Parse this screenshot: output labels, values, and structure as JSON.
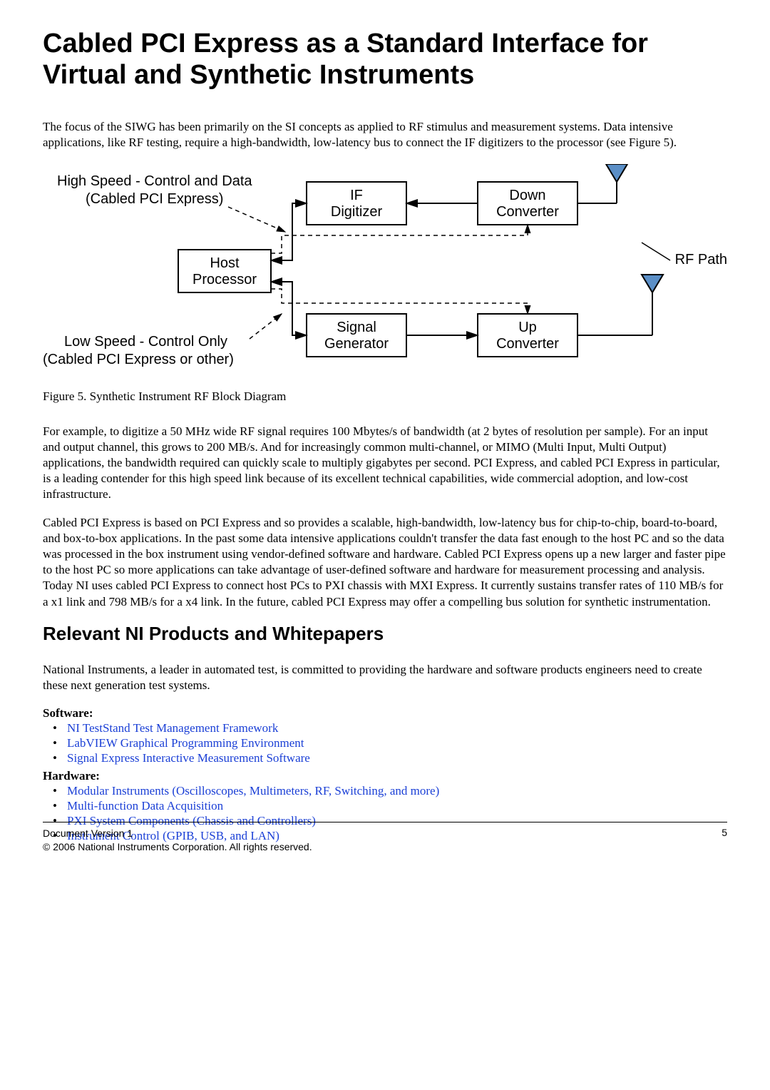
{
  "title": "Cabled PCI Express as a Standard Interface for Virtual and Synthetic Instruments",
  "intro": "The focus of the SIWG has been primarily on the SI concepts as applied to RF stimulus and measurement systems. Data intensive applications, like RF testing, require a high-bandwidth, low-latency bus to connect the IF digitizers to the processor (see Figure 5).",
  "diagram": {
    "high_speed_line1": "High Speed - Control and Data",
    "high_speed_line2": "(Cabled PCI Express)",
    "host_line1": "Host",
    "host_line2": "Processor",
    "if_line1": "IF",
    "if_line2": "Digitizer",
    "signal_line1": "Signal",
    "signal_line2": "Generator",
    "down_line1": "Down",
    "down_line2": "Converter",
    "up_line1": "Up",
    "up_line2": "Converter",
    "rf_path": "RF Path",
    "low_speed_line1": "Low Speed - Control Only",
    "low_speed_line2": "(Cabled PCI Express or other)"
  },
  "figcap": "Figure 5. Synthetic Instrument RF Block Diagram",
  "para2": "For example, to digitize a 50 MHz wide RF signal requires 100 Mbytes/s of bandwidth (at 2 bytes of resolution per sample). For an input and output channel, this grows to 200 MB/s. And for increasingly common multi-channel, or MIMO (Multi Input, Multi Output) applications, the bandwidth required can quickly scale to multiply gigabytes per second. PCI Express, and cabled PCI Express in particular, is a leading contender for this high speed link because of its excellent technical capabilities, wide commercial adoption, and low-cost infrastructure.",
  "para3": "Cabled PCI Express is based on PCI Express and so provides a scalable, high-bandwidth, low-latency bus for chip-to-chip, board-to-board, and box-to-box applications. In the past some data intensive applications couldn't transfer the data fast enough to the host PC and so the data was processed in the box instrument using vendor-defined software and hardware. Cabled PCI Express opens up a new larger and faster pipe to the host PC so more applications can take advantage of user-defined software and hardware for measurement processing and analysis. Today NI uses cabled PCI Express to connect host PCs to PXI chassis with MXI Express. It currently sustains transfer rates of 110 MB/s for a x1 link and 798 MB/s for a x4 link. In the future, cabled PCI Express may offer a compelling bus solution for synthetic instrumentation.",
  "section2": "Relevant NI Products and Whitepapers",
  "para4": "National Instruments, a leader in automated test, is committed to providing the hardware and software products engineers need to create these next generation test systems.",
  "software_heading": "Software:",
  "software_links": [
    "NI TestStand Test Management Framework",
    "LabVIEW Graphical Programming Environment",
    "Signal Express Interactive Measurement Software"
  ],
  "hardware_heading": "Hardware",
  "hardware_links": [
    "Modular Instruments (Oscilloscopes, Multimeters, RF, Switching, and more)",
    "Multi-function Data Acquisition",
    "PXI System Components (Chassis and Controllers)",
    "Instrument Control (GPIB, USB, and LAN)"
  ],
  "footer": {
    "version": "Document Version 1",
    "copyright": "© 2006 National Instruments Corporation. All rights reserved.",
    "page": "5"
  }
}
